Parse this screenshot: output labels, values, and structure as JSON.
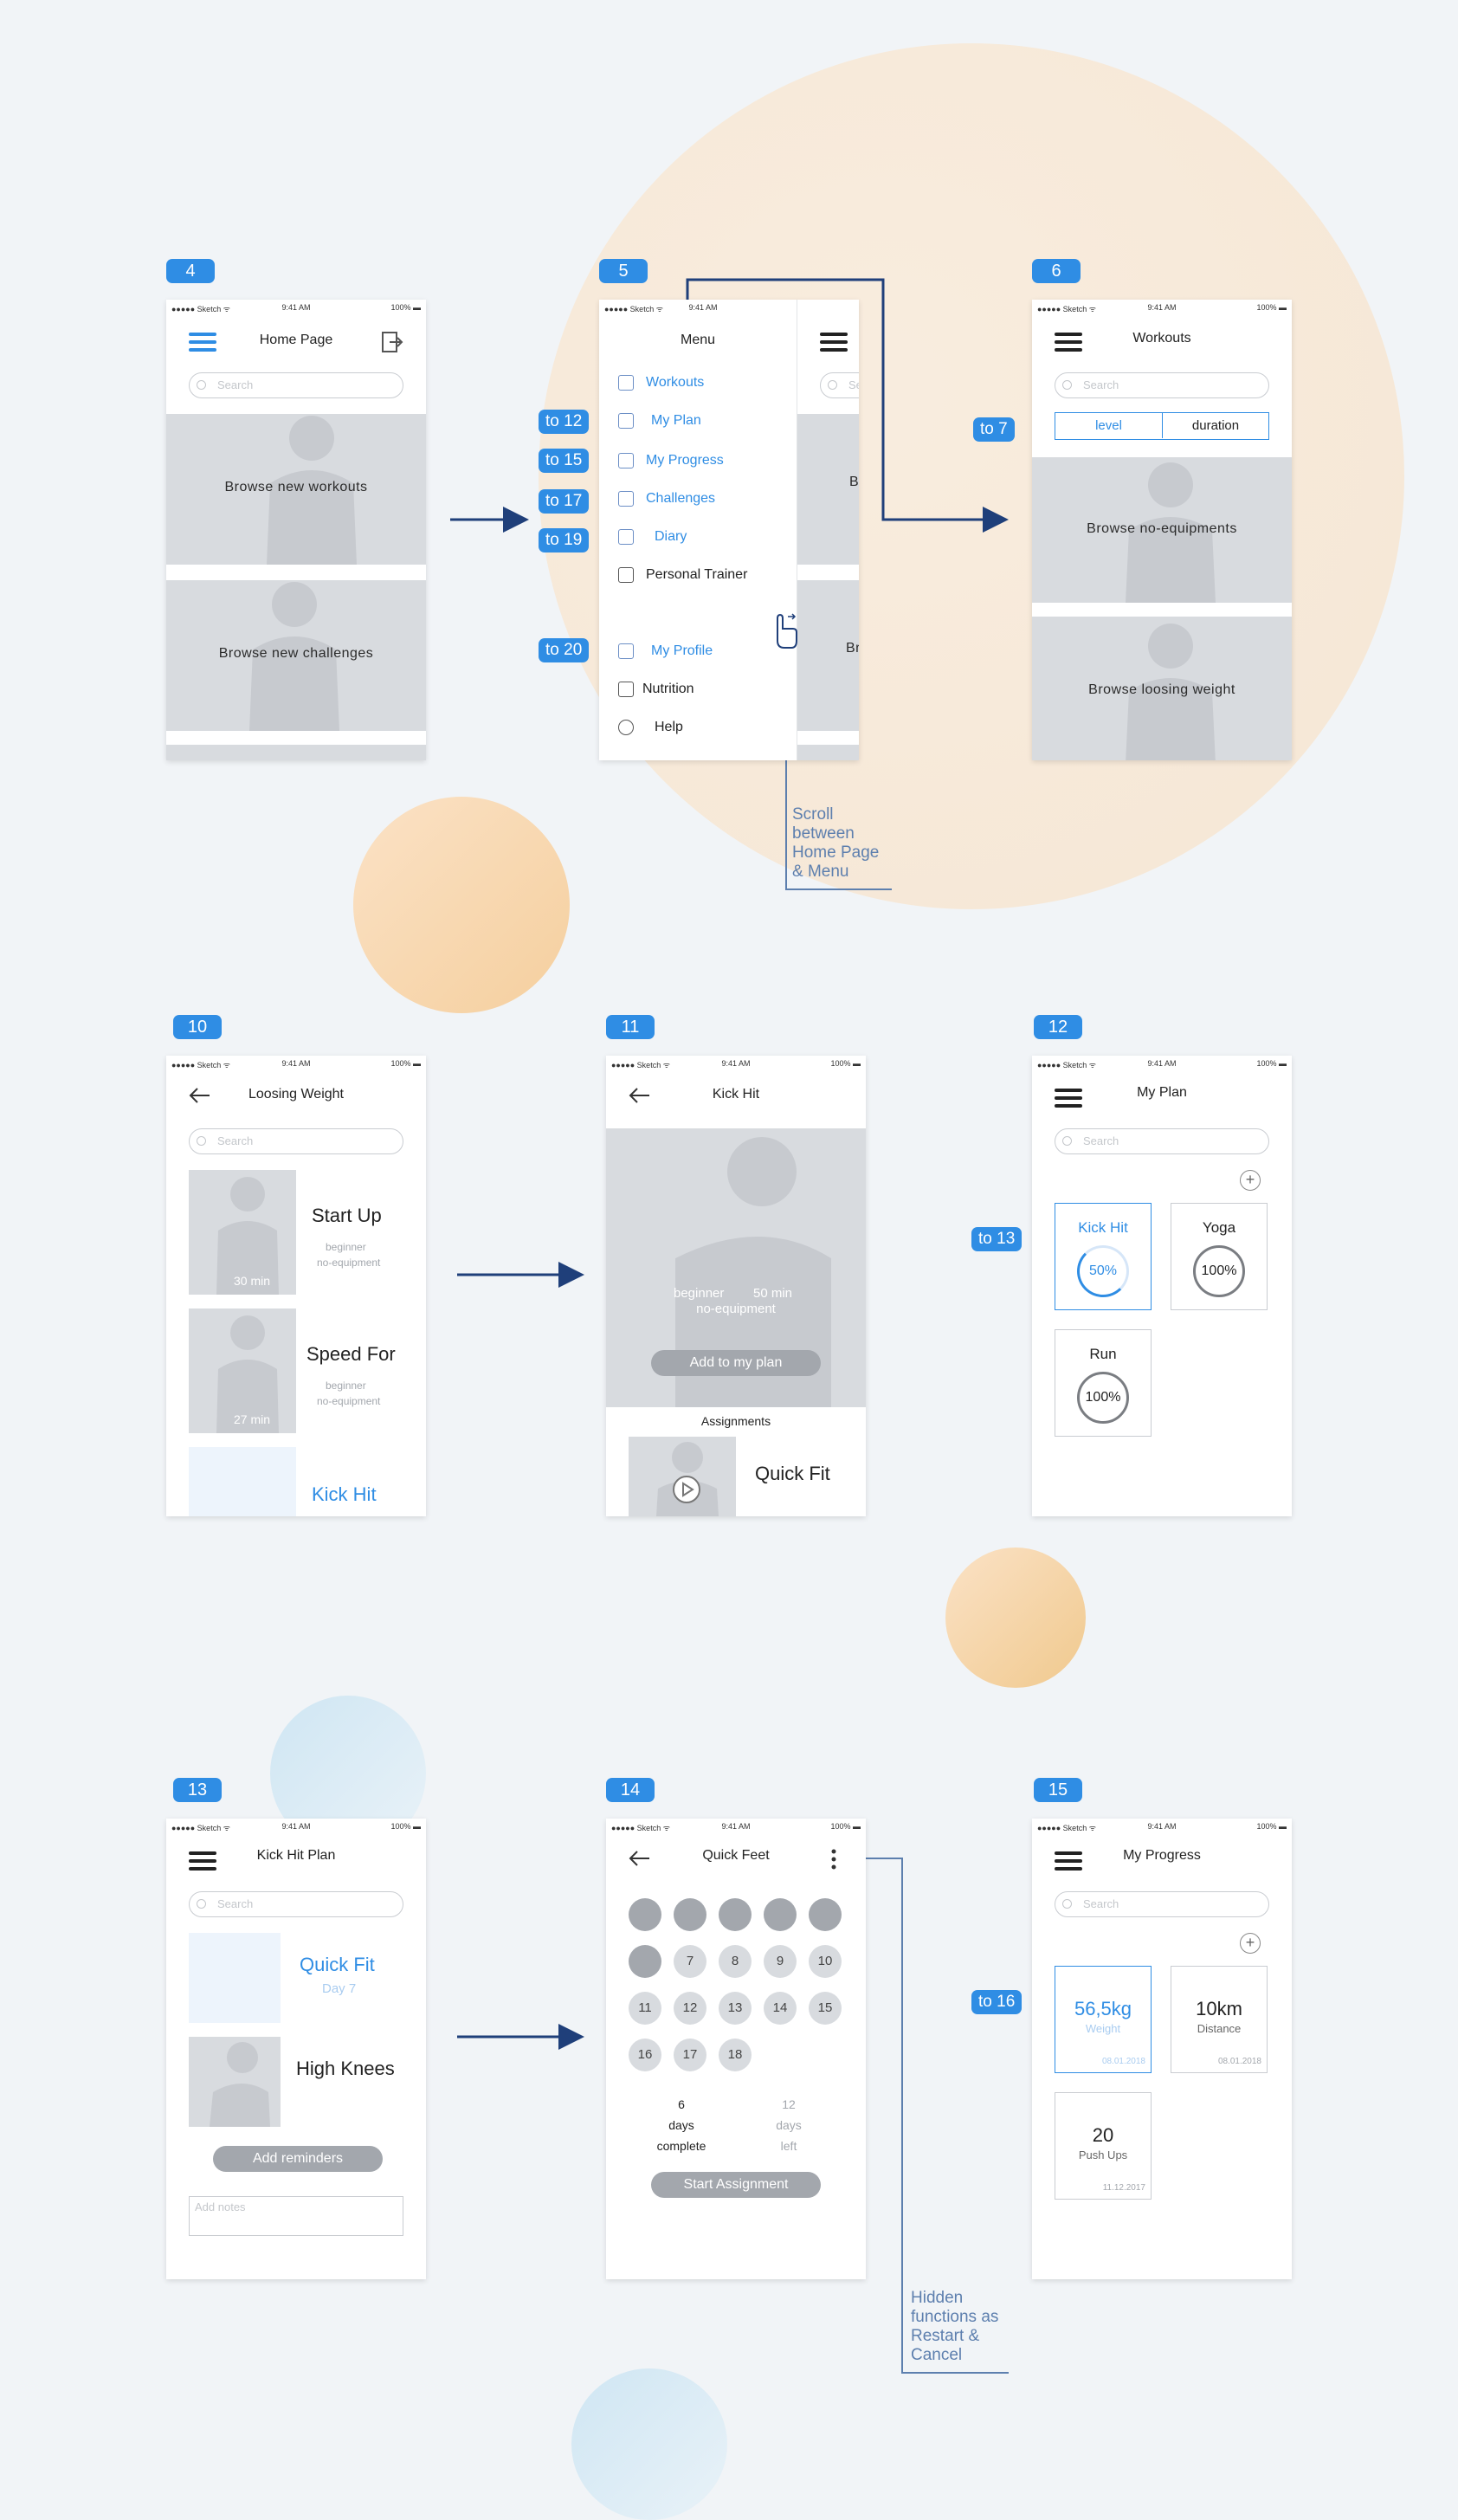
{
  "badges": {
    "b4": "4",
    "b5": "5",
    "b6": "6",
    "b10": "10",
    "b11": "11",
    "b12": "12",
    "b13": "13",
    "b14": "14",
    "b15": "15"
  },
  "tags": {
    "to12": "to 12",
    "to15": "to 15",
    "to17": "to 17",
    "to19": "to 19",
    "to20": "to 20",
    "to7": "to 7",
    "to13": "to 13",
    "to16": "to 16"
  },
  "status": {
    "left": "●●●●● Sketch ᯤ",
    "time": "9:41 AM",
    "battery": "100% ▬"
  },
  "s4": {
    "title": "Home Page",
    "search": "Search",
    "card1": "Browse new workouts",
    "card2": "Browse new challenges"
  },
  "s5": {
    "title": "Menu",
    "items": [
      "Workouts",
      "My Plan",
      "My Progress",
      "Challenges",
      "Diary",
      "Personal Trainer",
      "My Profile",
      "Nutrition",
      "Help"
    ],
    "peek_search": "Se",
    "peek1": "B",
    "peek2": "Br"
  },
  "s6": {
    "title": "Workouts",
    "search": "Search",
    "seg_level": "level",
    "seg_duration": "duration",
    "card1": "Browse no-equipments",
    "card2": "Browse loosing weight"
  },
  "note1": [
    "Scroll",
    "between",
    "Home Page",
    "& Menu"
  ],
  "s10": {
    "title": "Loosing Weight",
    "search": "Search",
    "items": [
      {
        "name": "Start Up",
        "meta1": "beginner",
        "meta2": "no-equipment",
        "time": "30 min"
      },
      {
        "name": "Speed For",
        "meta1": "beginner",
        "meta2": "no-equipment",
        "time": "27 min"
      },
      {
        "name": "Kick Hit"
      }
    ]
  },
  "s11": {
    "title": "Kick Hit",
    "level": "beginner",
    "duration": "50 min",
    "equipment": "no-equipment",
    "add_btn": "Add to my plan",
    "assignments": "Assignments",
    "item": "Quick Fit"
  },
  "s12": {
    "title": "My Plan",
    "search": "Search",
    "cards": [
      {
        "name": "Kick Hit",
        "pct": "50%",
        "progress": 0.5
      },
      {
        "name": "Yoga",
        "pct": "100%",
        "progress": 1
      },
      {
        "name": "Run",
        "pct": "100%",
        "progress": 1
      }
    ]
  },
  "s13": {
    "title": "Kick Hit Plan",
    "search": "Search",
    "item1": "Quick Fit",
    "item1_sub": "Day 7",
    "item2": "High Knees",
    "reminder_btn": "Add reminders",
    "notes_placeholder": "Add notes"
  },
  "s14": {
    "title": "Quick Feet",
    "days": [
      "7",
      "8",
      "9",
      "10",
      "11",
      "12",
      "13",
      "14",
      "15",
      "16",
      "17",
      "18"
    ],
    "complete_n": "6",
    "complete_l1": "days",
    "complete_l2": "complete",
    "left_n": "12",
    "left_l1": "days",
    "left_l2": "left",
    "start_btn": "Start Assignment"
  },
  "note2": [
    "Hidden",
    "functions as",
    "Restart &",
    "Cancel"
  ],
  "s15": {
    "title": "My Progress",
    "search": "Search",
    "cards": [
      {
        "value": "56,5kg",
        "label": "Weight",
        "date": "08.01.2018"
      },
      {
        "value": "10km",
        "label": "Distance",
        "date": "08.01.2018"
      },
      {
        "value": "20",
        "label": "Push Ups",
        "date": "11.12.2017"
      }
    ]
  },
  "colors": {
    "accent": "#2f8de4",
    "connector": "#1f3f7a",
    "placeholder": "#d8dbdf"
  }
}
